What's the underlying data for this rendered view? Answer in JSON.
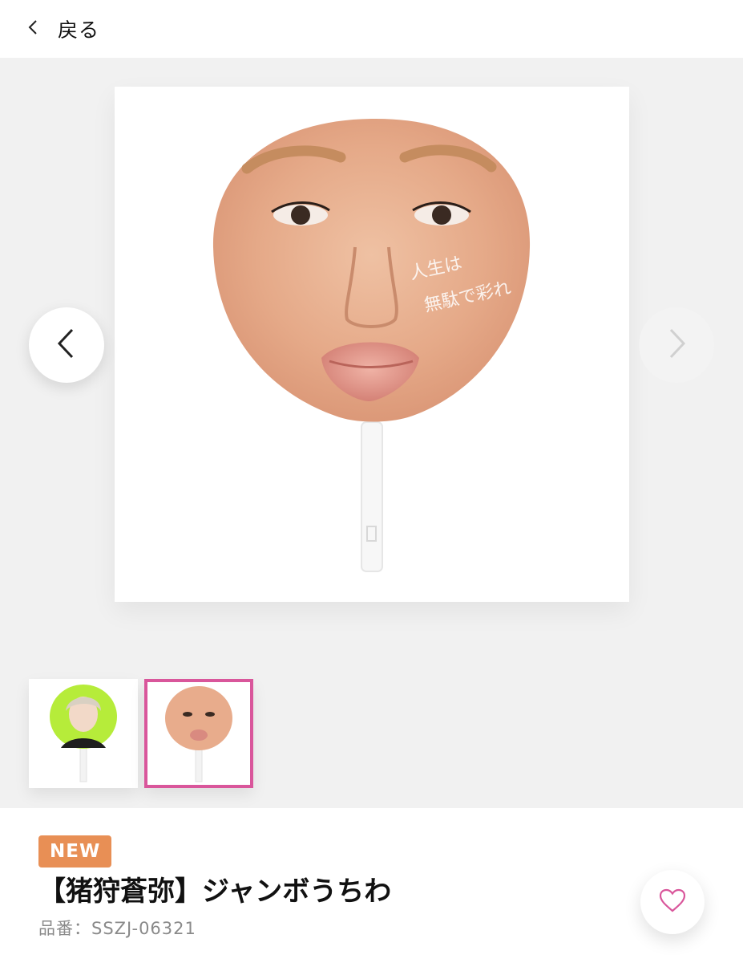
{
  "header": {
    "back_icon": "chevron-left-icon",
    "back_label": "戻る"
  },
  "gallery": {
    "prev_icon": "chevron-left-icon",
    "next_icon": "chevron-right-icon",
    "main_image_text": "人生は無駄で彩れ",
    "thumbnails": [
      {
        "selected": false
      },
      {
        "selected": true
      }
    ],
    "selected_border_color": "#d9569b"
  },
  "product": {
    "badge": "NEW",
    "badge_color": "#e88f55",
    "title": "【猪狩蒼弥】ジャンボうちわ",
    "code": "品番：SSZJ-06321",
    "favorite_icon": "heart-icon",
    "favorite_color": "#d9569b"
  }
}
